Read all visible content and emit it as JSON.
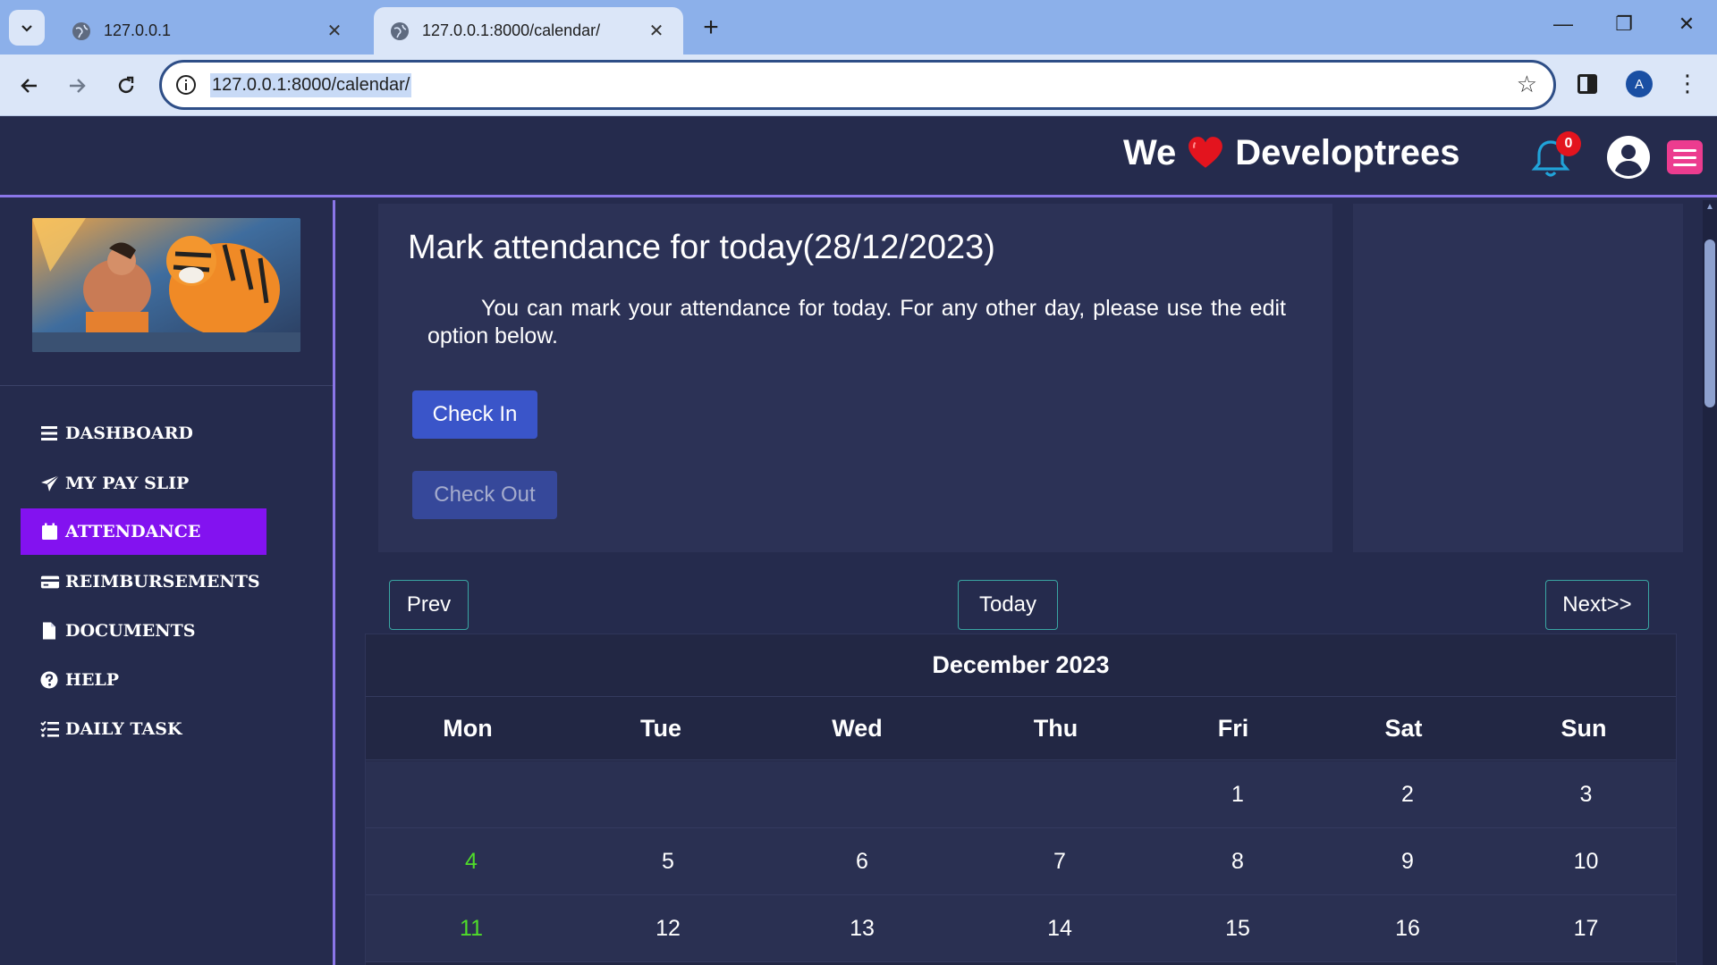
{
  "browser": {
    "tabs": [
      {
        "title": "127.0.0.1",
        "active": false
      },
      {
        "title": "127.0.0.1:8000/calendar/",
        "active": true
      }
    ],
    "url": "127.0.0.1:8000/calendar/",
    "profile_initial": "A"
  },
  "header": {
    "brand_prefix": "We",
    "brand_suffix": "Developtrees",
    "notification_count": "0"
  },
  "sidebar": {
    "items": [
      {
        "label": "DASHBOARD",
        "icon": "bars-icon",
        "active": false
      },
      {
        "label": "MY PAY SLIP",
        "icon": "paper-plane-icon",
        "active": false
      },
      {
        "label": "ATTENDANCE",
        "icon": "calendar-icon",
        "active": true
      },
      {
        "label": "REIMBURSEMENTS",
        "icon": "credit-card-icon",
        "active": false
      },
      {
        "label": "DOCUMENTS",
        "icon": "file-icon",
        "active": false
      },
      {
        "label": "HELP",
        "icon": "question-circle-icon",
        "active": false
      },
      {
        "label": "DAILY TASK",
        "icon": "list-icon",
        "active": false
      }
    ]
  },
  "attendance": {
    "title": "Mark attendance for today(28/12/2023)",
    "description": "You can mark your attendance for today. For any other day, please use the edit option below.",
    "check_in_label": "Check In",
    "check_out_label": "Check Out"
  },
  "calendar": {
    "prev_label": "Prev",
    "today_label": "Today",
    "next_label": "Next>>",
    "month": "December 2023",
    "weekdays": [
      "Mon",
      "Tue",
      "Wed",
      "Thu",
      "Fri",
      "Sat",
      "Sun"
    ],
    "weeks": [
      [
        "",
        "",
        "",
        "",
        "1",
        "2",
        "3"
      ],
      [
        "4",
        "5",
        "6",
        "7",
        "8",
        "9",
        "10"
      ],
      [
        "11",
        "12",
        "13",
        "14",
        "15",
        "16",
        "17"
      ]
    ]
  },
  "colors": {
    "accent": "#8312f0",
    "header_bg": "#252b4d",
    "primary_button": "#3a55c9",
    "highlight_day": "#4fdc2a",
    "badge": "#e3141e"
  }
}
